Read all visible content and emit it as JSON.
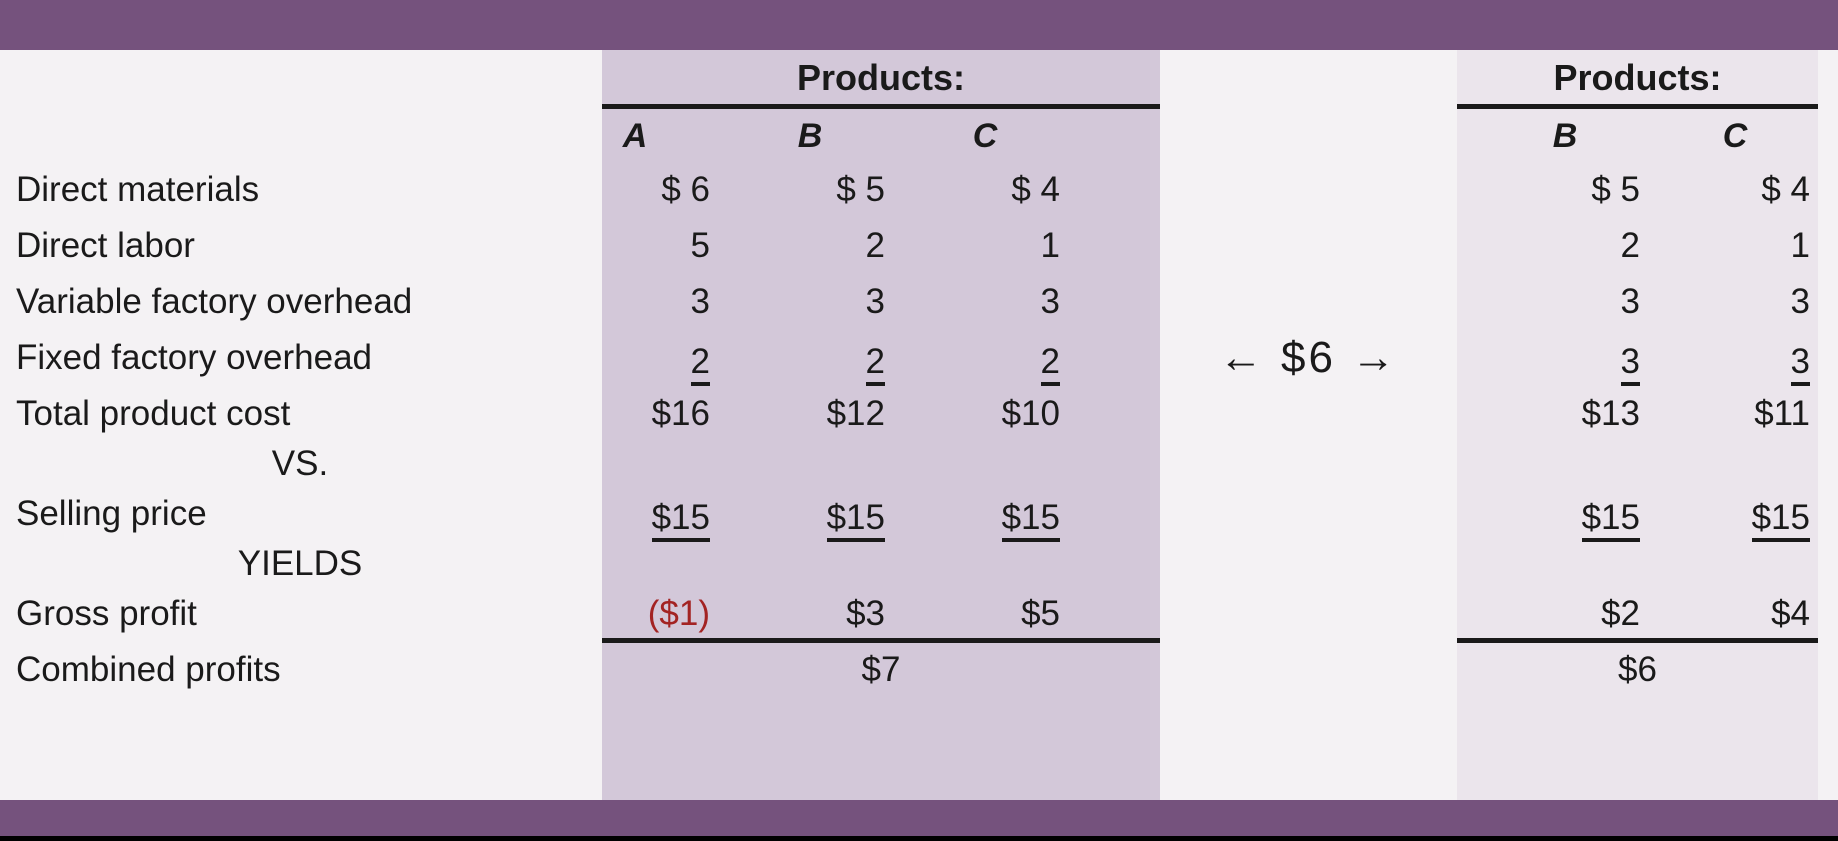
{
  "theme": {
    "band_color": "#75527D",
    "page_background": "#F4F2F4",
    "panel_left_color": "#D3C8D9",
    "panel_right_color": "#EBE5EC",
    "text_color": "#1A1A1A",
    "negative_color": "#A32323"
  },
  "left_table": {
    "header": "Products:",
    "columns": [
      "A",
      "B",
      "C"
    ]
  },
  "right_table": {
    "header": "Products:",
    "columns": [
      "B",
      "C"
    ]
  },
  "middle": {
    "annotation": "← $6 →"
  },
  "rows": {
    "direct_materials": {
      "label": "Direct materials",
      "left": [
        "$  6",
        "$  5",
        "$  4"
      ],
      "right": [
        "$  5",
        "$  4"
      ]
    },
    "direct_labor": {
      "label": "Direct labor",
      "left": [
        "5",
        "2",
        "1"
      ],
      "right": [
        "2",
        "1"
      ]
    },
    "variable_factory_overhead": {
      "label": "Variable factory overhead",
      "left": [
        "3",
        "3",
        "3"
      ],
      "right": [
        "3",
        "3"
      ]
    },
    "fixed_factory_overhead": {
      "label": "Fixed factory overhead",
      "left": [
        "2",
        "2",
        "2"
      ],
      "right": [
        "3",
        "3"
      ]
    },
    "total_product_cost": {
      "label": "Total product cost",
      "left": [
        "$16",
        "$12",
        "$10"
      ],
      "right": [
        "$13",
        "$11"
      ]
    },
    "vs": {
      "label": "VS."
    },
    "selling_price": {
      "label": "Selling price",
      "left": [
        "$15",
        "$15",
        "$15"
      ],
      "right": [
        "$15",
        "$15"
      ]
    },
    "yields": {
      "label": "YIELDS"
    },
    "gross_profit": {
      "label": "Gross profit",
      "left": [
        "($1)",
        "$3",
        "$5"
      ],
      "right": [
        "$2",
        "$4"
      ]
    },
    "combined_profits": {
      "label": "Combined profits",
      "left_total": "$7",
      "right_total": "$6"
    }
  }
}
